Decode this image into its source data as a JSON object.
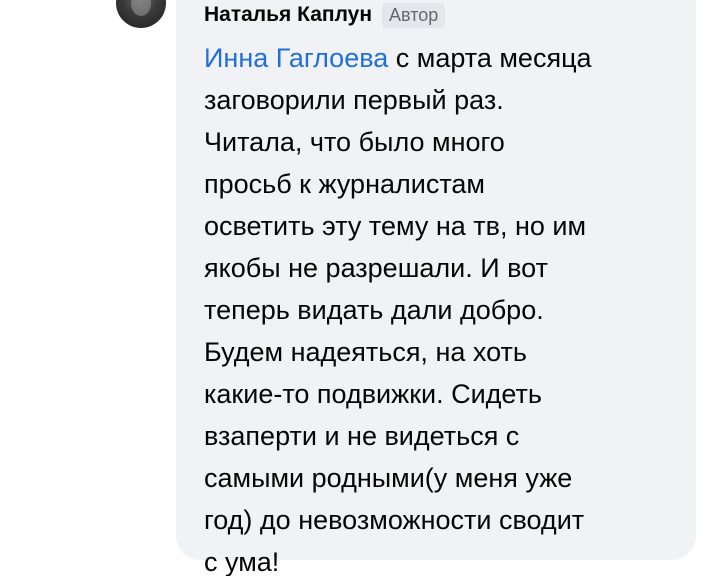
{
  "comment": {
    "author_name": "Наталья Каплун",
    "author_badge": "Автор",
    "mention": "Инна Гаглоева",
    "lines": [
      " с марта месяца",
      "заговорили первый раз.",
      "Читала, что было много",
      "просьб к журналистам",
      "осветить эту тему на тв, но им",
      "якобы не разрешали. И вот",
      "теперь видать дали добро.",
      "Будем надеяться, на хоть",
      "какие-то подвижки. Сидеть",
      "взаперти и не видеться с",
      "самыми родными(у меня уже",
      "год) до невозможности сводит",
      "с ума!"
    ]
  },
  "colors": {
    "bubble_background": "#f0f2f5",
    "mention": "#216fdb",
    "badge_background": "#e4e6eb",
    "badge_text": "#65676b",
    "text": "#050505"
  }
}
